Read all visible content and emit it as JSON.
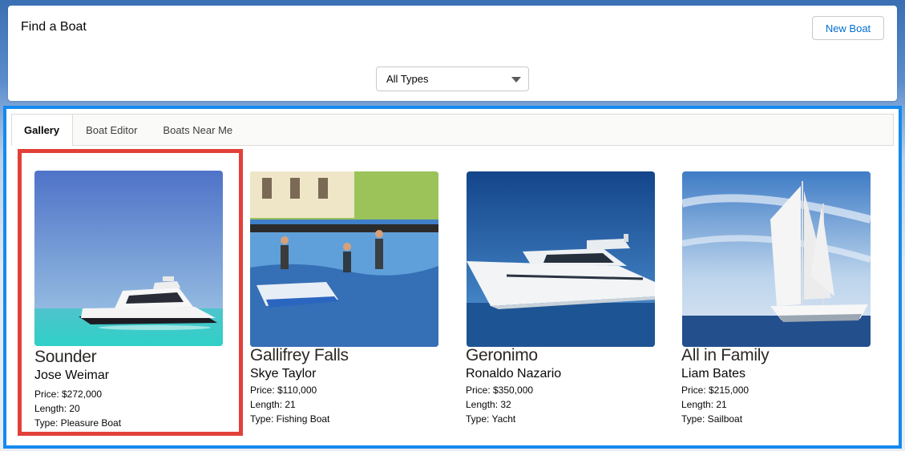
{
  "header": {
    "title": "Find a Boat",
    "new_boat_label": "New Boat",
    "type_filter": {
      "selected": "All Types"
    }
  },
  "tabs": [
    {
      "label": "Gallery",
      "active": true
    },
    {
      "label": "Boat Editor",
      "active": false
    },
    {
      "label": "Boats Near Me",
      "active": false
    }
  ],
  "boats": [
    {
      "name": "Sounder",
      "owner": "Jose Weimar",
      "price": "Price: $272,000",
      "length": "Length: 20",
      "type": "Type: Pleasure Boat",
      "selected": true
    },
    {
      "name": "Gallifrey Falls",
      "owner": "Skye Taylor",
      "price": "Price: $110,000",
      "length": "Length: 21",
      "type": "Type: Fishing Boat",
      "selected": false
    },
    {
      "name": "Geronimo",
      "owner": "Ronaldo Nazario",
      "price": "Price: $350,000",
      "length": "Length: 32",
      "type": "Type: Yacht",
      "selected": false
    },
    {
      "name": "All in Family",
      "owner": "Liam Bates",
      "price": "Price: $215,000",
      "length": "Length: 21",
      "type": "Type: Sailboat",
      "selected": false
    }
  ],
  "colors": {
    "accent": "#0070d2",
    "focus_border": "#1589ee",
    "selected_border": "#e2403a"
  }
}
